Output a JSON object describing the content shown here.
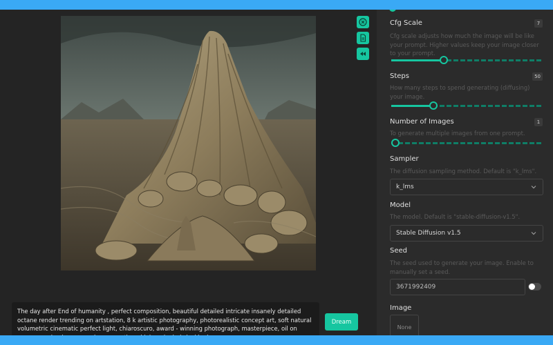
{
  "image_panel": {
    "icons": [
      "close-circle-icon",
      "document-icon",
      "rewind-icon"
    ]
  },
  "prompt": {
    "text": "The day after End of humanity , perfect composition, beautiful detailed intricate insanely detailed octane render trending on artstation, 8 k artistic photography, photorealistic concept art, soft natural volumetric cinematic perfect light, chiaroscuro, award - winning photograph, masterpiece, oil on canvas, raphael, caravaggio, greg rutkowski, beeple, beksinski, giger"
  },
  "dream_button": {
    "label": "Dream"
  },
  "settings": {
    "cfg_scale": {
      "title": "Cfg Scale",
      "value": "7",
      "description": "Cfg scale adjusts how much the image will be like your prompt. Higher values keep your image closer to your prompt.",
      "slider_fraction": 0.35
    },
    "steps": {
      "title": "Steps",
      "value": "50",
      "description": "How many steps to spend generating (diffusing) your image.",
      "slider_fraction": 0.28
    },
    "num_images": {
      "title": "Number of Images",
      "value": "1",
      "description": "To generate multiple images from one prompt.",
      "slider_fraction": 0.0
    },
    "sampler": {
      "title": "Sampler",
      "description": "The diffusion sampling method. Default is \"k_lms\".",
      "selected": "k_lms"
    },
    "model": {
      "title": "Model",
      "description": "The model. Default is \"stable-diffusion-v1.5\".",
      "selected": "Stable Diffusion v1.5"
    },
    "seed": {
      "title": "Seed",
      "description": "The seed used to generate your image. Enable to manually set a seed.",
      "value": "3671992409",
      "enabled": false
    },
    "image": {
      "title": "Image",
      "value": "None"
    }
  },
  "colors": {
    "accent": "#16c6a0",
    "background": "#242424",
    "panel": "#2b2b2b",
    "frame": "#3aa9f5"
  }
}
